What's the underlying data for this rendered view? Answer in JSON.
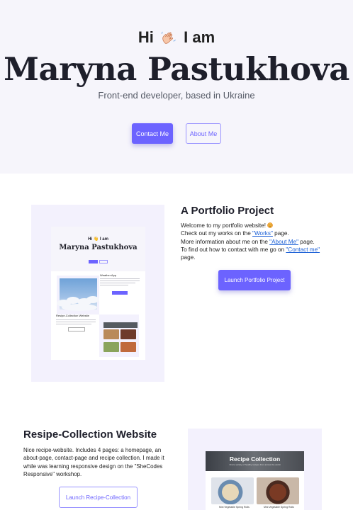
{
  "hero": {
    "greeting_before": "Hi",
    "greeting_after": "I am",
    "name": "Maryna Pastukhova",
    "subtitle": "Front-end developer, based in Ukraine",
    "contact_button": "Contact Me",
    "about_button": "About Me"
  },
  "project1": {
    "title": "A Portfolio Project",
    "line1": "Welcome to my portfolio website!",
    "line2_before": "Check out my works on the ",
    "line2_link": "\"Works\"",
    "line2_after": " page.",
    "line3_before": "More information about me on the ",
    "line3_link": "\"About Me\"",
    "line3_after": " page.",
    "line4_before": "To find out how to contact with me go on ",
    "line4_link": "\"Contact me\"",
    "line4_after": "page.",
    "button": "Launch Portfolio Project",
    "preview": {
      "hi": "Hi 👋 I am",
      "name": "Maryna Pastukhova",
      "weather_title": "Weather App",
      "recipe_title": "Resipe-Collection Website",
      "recipe_banner": "Recipe Collection"
    }
  },
  "project2": {
    "title": "Resipe-Collection Website",
    "description": "Nice recipe-website. Includes 4 pages: a homepage, an about-page, contact-page and recipe collection. I made it while was learning responsive design on the \"SheCodes Responsive\" workshop.",
    "button": "Launch Recipe-Collection",
    "preview": {
      "banner_title": "Recipe Collection",
      "banner_sub": "Find a variety of healthy recipes from across the world",
      "dish1": "Mini Vegetable Spring Rolls",
      "dish2": "Mini Vegetable Spring Rolls"
    }
  },
  "colors": {
    "accent": "#6c63ff",
    "hero_bg": "#f6f5fb",
    "frame_bg": "#f3f1fd",
    "link": "#1a5fd6"
  }
}
